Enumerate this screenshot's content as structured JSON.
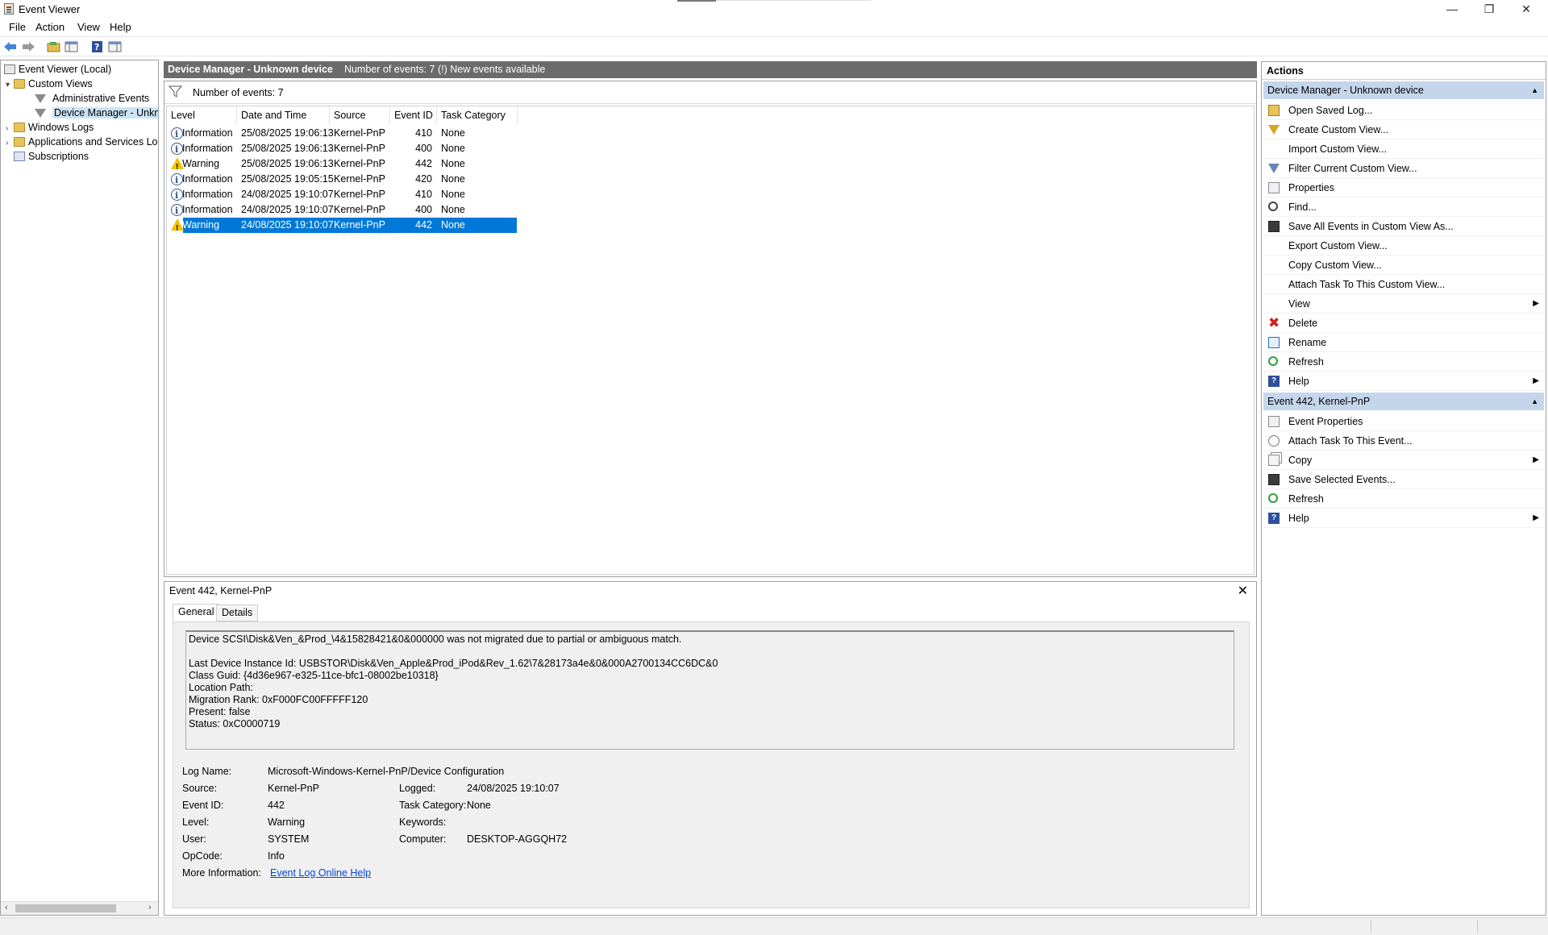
{
  "window": {
    "title": "Event Viewer",
    "minimize_glyph": "—",
    "restore_glyph": "❐",
    "close_glyph": "✕"
  },
  "menu": [
    "File",
    "Action",
    "View",
    "Help"
  ],
  "toolbar_icons": [
    "back-arrow-icon",
    "forward-arrow-icon",
    "open-folder-icon",
    "show-hide-tree-icon",
    "help-icon",
    "show-hide-action-pane-icon"
  ],
  "tree": {
    "items": [
      {
        "label": "Event Viewer (Local)",
        "icon": "computer-icon",
        "expander": ""
      },
      {
        "label": "Custom Views",
        "icon": "folder-icon",
        "expander": "▾"
      },
      {
        "label": "Administrative Events",
        "icon": "filter-icon",
        "expander": ""
      },
      {
        "label": "Device Manager - Unknown device",
        "icon": "filter-icon",
        "expander": ""
      },
      {
        "label": "Windows Logs",
        "icon": "folder-icon",
        "expander": "›"
      },
      {
        "label": "Applications and Services Logs",
        "icon": "folder-icon",
        "expander": "›"
      },
      {
        "label": "Subscriptions",
        "icon": "log-icon",
        "expander": ""
      }
    ],
    "scroll_left": "‹",
    "scroll_right": "›"
  },
  "center": {
    "view_name": "Device Manager - Unknown device",
    "event_count_text": "Number of events: 7 (!) New events available",
    "filter_text": "Number of events: 7"
  },
  "grid": {
    "columns": [
      "Level",
      "Date and Time",
      "Source",
      "Event ID",
      "Task Category"
    ],
    "rows": [
      {
        "level": "Information",
        "type": "info",
        "datetime": "25/08/2025 19:06:13",
        "source": "Kernel-PnP",
        "event_id": "410",
        "task": "None"
      },
      {
        "level": "Information",
        "type": "info",
        "datetime": "25/08/2025 19:06:13",
        "source": "Kernel-PnP",
        "event_id": "400",
        "task": "None"
      },
      {
        "level": "Warning",
        "type": "warn",
        "datetime": "25/08/2025 19:06:13",
        "source": "Kernel-PnP",
        "event_id": "442",
        "task": "None"
      },
      {
        "level": "Information",
        "type": "info",
        "datetime": "25/08/2025 19:05:15",
        "source": "Kernel-PnP",
        "event_id": "420",
        "task": "None"
      },
      {
        "level": "Information",
        "type": "info",
        "datetime": "24/08/2025 19:10:07",
        "source": "Kernel-PnP",
        "event_id": "410",
        "task": "None"
      },
      {
        "level": "Information",
        "type": "info",
        "datetime": "24/08/2025 19:10:07",
        "source": "Kernel-PnP",
        "event_id": "400",
        "task": "None"
      },
      {
        "level": "Warning",
        "type": "warn",
        "datetime": "24/08/2025 19:10:07",
        "source": "Kernel-PnP",
        "event_id": "442",
        "task": "None",
        "selected": true
      }
    ]
  },
  "detail": {
    "title": "Event 442, Kernel-PnP",
    "close_glyph": "✕",
    "tabs": [
      "General",
      "Details"
    ],
    "description": "Device SCSI\\Disk&Ven_&Prod_\\4&15828421&0&000000 was not migrated due to partial or ambiguous match.\n\nLast Device Instance Id: USBSTOR\\Disk&Ven_Apple&Prod_iPod&Rev_1.62\\7&28173a4e&0&000A2700134CC6DC&0\nClass Guid: {4d36e967-e325-11ce-bfc1-08002be10318}\nLocation Path:\nMigration Rank: 0xF000FC00FFFFF120\nPresent: false\nStatus: 0xC0000719",
    "fields": {
      "log_name_label": "Log Name:",
      "log_name": "Microsoft-Windows-Kernel-PnP/Device Configuration",
      "source_label": "Source:",
      "source": "Kernel-PnP",
      "logged_label": "Logged:",
      "logged": "24/08/2025 19:10:07",
      "event_id_label": "Event ID:",
      "event_id": "442",
      "task_label": "Task Category:",
      "task": "None",
      "level_label": "Level:",
      "level": "Warning",
      "keywords_label": "Keywords:",
      "keywords": "",
      "user_label": "User:",
      "user": "SYSTEM",
      "computer_label": "Computer:",
      "computer": "DESKTOP-AGGQH72",
      "opcode_label": "OpCode:",
      "opcode": "Info",
      "more_info_label": "More Information:",
      "more_info_link": "Event Log Online Help"
    }
  },
  "actions": {
    "header": "Actions",
    "sections": [
      {
        "title": "Device Manager - Unknown device",
        "items": [
          {
            "label": "Open Saved Log...",
            "icon": "open-log-icon"
          },
          {
            "label": "Create Custom View...",
            "icon": "create-filter-icon"
          },
          {
            "label": "Import Custom View...",
            "icon": ""
          },
          {
            "label": "Filter Current Custom View...",
            "icon": "filter-icon"
          },
          {
            "label": "Properties",
            "icon": "properties-icon"
          },
          {
            "label": "Find...",
            "icon": "find-icon"
          },
          {
            "label": "Save All Events in Custom View As...",
            "icon": "save-icon"
          },
          {
            "label": "Export Custom View...",
            "icon": ""
          },
          {
            "label": "Copy Custom View...",
            "icon": ""
          },
          {
            "label": "Attach Task To This Custom View...",
            "icon": ""
          },
          {
            "label": "View",
            "icon": "",
            "submenu": true
          },
          {
            "label": "Delete",
            "icon": "delete-icon"
          },
          {
            "label": "Rename",
            "icon": "rename-icon"
          },
          {
            "label": "Refresh",
            "icon": "refresh-icon"
          },
          {
            "label": "Help",
            "icon": "help-icon",
            "submenu": true
          }
        ]
      },
      {
        "title": "Event 442, Kernel-PnP",
        "items": [
          {
            "label": "Event Properties",
            "icon": "event-properties-icon"
          },
          {
            "label": "Attach Task To This Event...",
            "icon": "attach-task-icon"
          },
          {
            "label": "Copy",
            "icon": "copy-icon",
            "submenu": true
          },
          {
            "label": "Save Selected Events...",
            "icon": "save-icon"
          },
          {
            "label": "Refresh",
            "icon": "refresh-icon"
          },
          {
            "label": "Help",
            "icon": "help-icon",
            "submenu": true
          }
        ]
      }
    ],
    "collapse_glyph": "▲",
    "submenu_glyph": "▶"
  }
}
